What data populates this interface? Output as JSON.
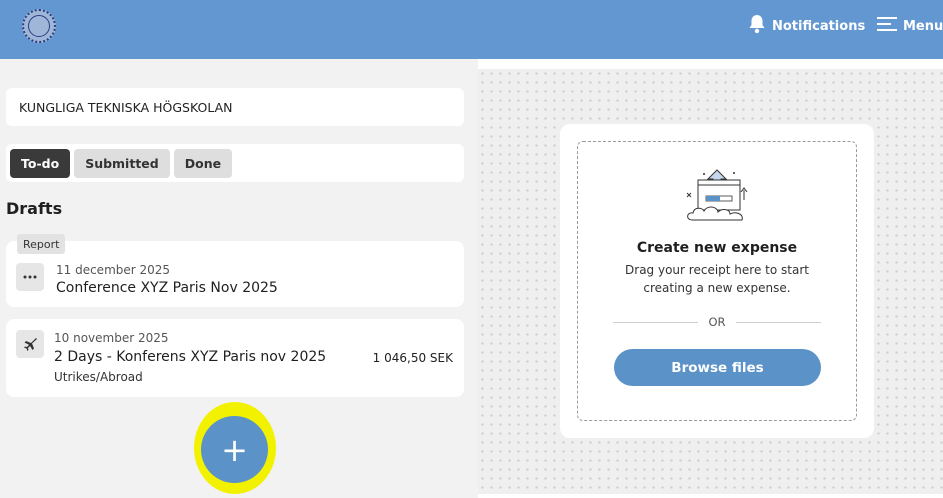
{
  "header": {
    "logo_icon": "kth-logo",
    "notifications_label": "Notifications",
    "notifications_icon": "bell-icon",
    "menu_label": "Menu",
    "menu_icon": "hamburger-icon",
    "bar_color": "#6397d1"
  },
  "organization": {
    "name": "KUNGLIGA TEKNISKA HÖGSKOLAN"
  },
  "tabs": [
    {
      "label": "To-do",
      "active": true
    },
    {
      "label": "Submitted",
      "active": false
    },
    {
      "label": "Done",
      "active": false
    }
  ],
  "drafts": {
    "title": "Drafts",
    "items": [
      {
        "tag": "Report",
        "icon": "more-icon",
        "date": "11 december 2025",
        "title": "Conference XYZ Paris Nov 2025"
      },
      {
        "icon": "airplane-icon",
        "date": "10 november 2025",
        "title": "2 Days - Konferens XYZ Paris nov 2025",
        "subtitle": "Utrikes/Abroad",
        "amount": "1 046,50 SEK"
      }
    ]
  },
  "fab": {
    "label": "+",
    "color": "#5b93c9",
    "highlight_color": "#f2f200"
  },
  "upload": {
    "illustration_icon": "upload-illustration",
    "title": "Create new expense",
    "description": "Drag your receipt here to start creating a new expense.",
    "or_label": "OR",
    "browse_label": "Browse files",
    "accent_color": "#5b93c9"
  }
}
